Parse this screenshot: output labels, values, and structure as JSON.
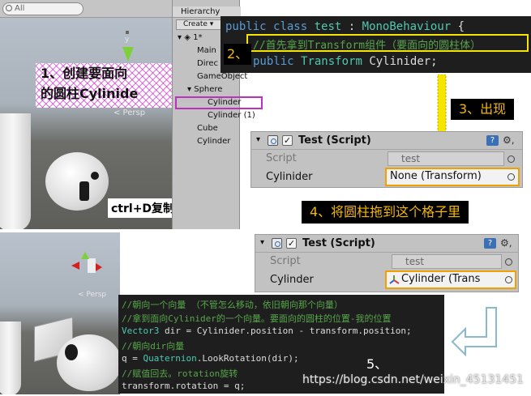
{
  "scene_view": {
    "search_placeholder": "All",
    "persp_label": "< Persp",
    "gizmo_y_label": "y"
  },
  "hierarchy": {
    "tab_label": "Hierarchy",
    "create_label": "Create",
    "root_label": "1*",
    "items": [
      "Main",
      "Direc",
      "GameObject",
      "Sphere",
      "Cylinder",
      "Cylinder (1)",
      "Cube",
      "Cylinder"
    ]
  },
  "code_top": {
    "line1": {
      "kw1": "public",
      "kw2": "class",
      "name": "test",
      "colon": ":",
      "base": "MonoBehaviour",
      "brace": "{"
    },
    "line2": {
      "comment": "//首先拿到Transform组件（要面向的圆柱体）"
    },
    "line3": {
      "kw": "public",
      "type": "Transform",
      "name": "Cylinider;"
    }
  },
  "annotations": {
    "step1_line1": "1、创建要面向",
    "step1_line2": "的圆柱Cylinide",
    "step2": "2、",
    "step3": "3、出现",
    "step4": "4、将圆柱拖到这个格子里",
    "step5": "5、",
    "ctrl_d": "ctrl+D复制物体",
    "watermark": "https://blog.csdn.net/weixin_45131451"
  },
  "inspector_top": {
    "title": "Test (Script)",
    "script_label": "Script",
    "script_value": "test",
    "field_label": "Cylinider",
    "field_value": "None (Transform)",
    "help": "?",
    "gear": "⚙,"
  },
  "inspector_bottom": {
    "title": "Test (Script)",
    "script_label": "Script",
    "script_value": "test",
    "field_label": "Cylinder",
    "field_value": "Cylinder (Trans",
    "help": "?",
    "gear": "⚙,"
  },
  "code_bottom": {
    "lines": [
      {
        "text": "//朝向一个向量  （不管怎么移动，依旧朝向那个向量）",
        "kind": "cm"
      },
      {
        "text": "//拿到面向Cylinider的一个向量。要面向的圆柱的位置-我的位置",
        "kind": "cm"
      },
      {
        "text": "Vector3 dir = Cylinider.position - transform.position;",
        "kind": "code1"
      },
      {
        "text": "//朝向dir向量",
        "kind": "cm"
      },
      {
        "text": "q = Quaternion.LookRotation(dir);",
        "kind": "code2"
      },
      {
        "text": "//赋值回去。rotation旋转",
        "kind": "cm"
      },
      {
        "text": "transform.rotation = q;",
        "kind": "plain"
      }
    ],
    "code1": {
      "type": "Vector3",
      "rest": " dir = Cylinider.position - transform.position;"
    },
    "code2": {
      "lhs": "q = ",
      "type": "Quaternion",
      "rest": ".LookRotation(dir);"
    }
  },
  "colors": {
    "callout_text": "#f5b800",
    "highlight_border": "#f0a000",
    "arrow_fill": "#f5e600",
    "return_arrow": "#b9dde8",
    "hatch": "#c800c8"
  }
}
